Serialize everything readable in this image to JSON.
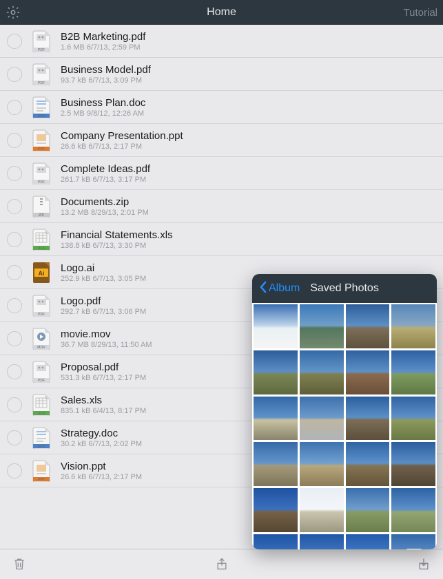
{
  "header": {
    "title": "Home",
    "tutorial_label": "Tutorial"
  },
  "files": [
    {
      "name": "B2B Marketing.pdf",
      "meta": "1.6 MB 6/7/13, 2:59 PM",
      "type": "pdf"
    },
    {
      "name": "Business Model.pdf",
      "meta": "93.7 kB 6/7/13, 3:09 PM",
      "type": "pdf"
    },
    {
      "name": "Business Plan.doc",
      "meta": "2.5 MB 9/8/12, 12:26 AM",
      "type": "doc"
    },
    {
      "name": "Company Presentation.ppt",
      "meta": "26.6 kB 6/7/13, 2:17 PM",
      "type": "ppt"
    },
    {
      "name": "Complete Ideas.pdf",
      "meta": "261.7 kB 6/7/13, 3:17 PM",
      "type": "pdf"
    },
    {
      "name": "Documents.zip",
      "meta": "13.2 MB 8/29/13, 2:01 PM",
      "type": "zip"
    },
    {
      "name": "Financial Statements.xls",
      "meta": "138.8 kB 6/7/13, 3:30 PM",
      "type": "xls"
    },
    {
      "name": "Logo.ai",
      "meta": "252.9 kB 6/7/13, 3:05 PM",
      "type": "ai"
    },
    {
      "name": "Logo.pdf",
      "meta": "292.7 kB 6/7/13, 3:06 PM",
      "type": "pdf"
    },
    {
      "name": "movie.mov",
      "meta": "36.7 MB 8/29/13, 11:50 AM",
      "type": "mov"
    },
    {
      "name": "Proposal.pdf",
      "meta": "531.3 kB 6/7/13, 2:17 PM",
      "type": "pdf"
    },
    {
      "name": "Sales.xls",
      "meta": "835.1 kB 6/4/13, 8:17 PM",
      "type": "xls"
    },
    {
      "name": "Strategy.doc",
      "meta": "30.2 kB 6/7/13, 2:02 PM",
      "type": "doc"
    },
    {
      "name": "Vision.ppt",
      "meta": "26.6 kB 6/7/13, 2:17 PM",
      "type": "ppt"
    }
  ],
  "popover": {
    "back_label": "Album",
    "title": "Saved Photos",
    "photo_count": 24,
    "thumb_palettes": [
      [
        "#3a6fb3",
        "#bcd3ea",
        "#e9f0f4",
        "#f5f5f5"
      ],
      [
        "#3c79b9",
        "#6f9fc7",
        "#54775f",
        "#748a6d"
      ],
      [
        "#2f5e9a",
        "#5c8fc6",
        "#7d6f58",
        "#5e523e"
      ],
      [
        "#5886b8",
        "#87a7c3",
        "#b8ad72",
        "#8d824c"
      ],
      [
        "#2d5d9b",
        "#5c8dc4",
        "#7a8656",
        "#5e6a3d"
      ],
      [
        "#3469a6",
        "#6294c7",
        "#7f8051",
        "#5e5f38"
      ],
      [
        "#2f619f",
        "#5d90c6",
        "#8a6a4e",
        "#6a4f38"
      ],
      [
        "#2c60a2",
        "#5c8fc8",
        "#7f9a60",
        "#5e7944"
      ],
      [
        "#3268a8",
        "#5e92c9",
        "#c7c1a2",
        "#8a846c"
      ],
      [
        "#3f70ad",
        "#6b9aca",
        "#bfb6a1",
        "#b0b3b9"
      ],
      [
        "#2b5e9e",
        "#5b8fc7",
        "#7b6d55",
        "#5c4f3c"
      ],
      [
        "#2f62a2",
        "#5e91c9",
        "#8c9a5f",
        "#6a7844"
      ],
      [
        "#3769a8",
        "#6395cb",
        "#a49a7a",
        "#7d745a"
      ],
      [
        "#3f73b0",
        "#6fa0cf",
        "#b7a77d",
        "#8c7d58"
      ],
      [
        "#2f64a4",
        "#5d91ca",
        "#847452",
        "#64553a"
      ],
      [
        "#2c5e9f",
        "#5a8dc5",
        "#6f604b",
        "#514534"
      ],
      [
        "#1f51a0",
        "#3c70bd",
        "#746147",
        "#564631"
      ],
      [
        "#e8eef5",
        "#f4f6f9",
        "#cac5b0",
        "#9c977f"
      ],
      [
        "#3a6fad",
        "#709ecc",
        "#869b65",
        "#697e4b"
      ],
      [
        "#2e63a4",
        "#5c90ca",
        "#93a573",
        "#758857"
      ],
      [
        "#1e53a6",
        "#3e72be",
        "#8a7754",
        "#6c5b3d"
      ],
      [
        "#2257a8",
        "#4478c0",
        "#6d7c55",
        "#4f5e3a"
      ],
      [
        "#225aad",
        "#477dc5",
        "#8faa6c",
        "#738e52"
      ],
      [
        "#3167a8",
        "#5e91cb",
        "#8a7d63",
        "#6a5e48"
      ]
    ]
  },
  "icons": {
    "gear": "gear-icon",
    "trash": "trash-icon",
    "share": "share-icon",
    "download": "download-icon",
    "back": "chevron-left-icon"
  }
}
